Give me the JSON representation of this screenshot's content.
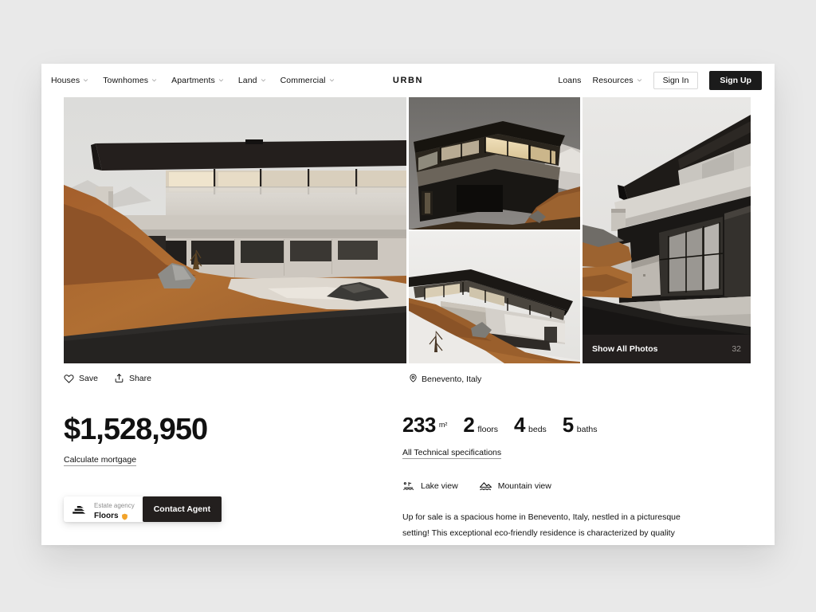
{
  "nav": {
    "left_items": [
      {
        "label": "Houses",
        "has_chevron": true,
        "icon": "chevron-down-icon"
      },
      {
        "label": "Townhomes",
        "has_chevron": true,
        "icon": "chevron-down-icon"
      },
      {
        "label": "Apartments",
        "has_chevron": true,
        "icon": "chevron-down-icon"
      },
      {
        "label": "Land",
        "has_chevron": true,
        "icon": "chevron-down-icon"
      },
      {
        "label": "Commercial",
        "has_chevron": true,
        "icon": "chevron-down-icon"
      }
    ],
    "brand": "URBN",
    "right_items": [
      {
        "label": "Loans",
        "has_chevron": false
      },
      {
        "label": "Resources",
        "has_chevron": true,
        "icon": "chevron-down-icon"
      }
    ],
    "sign_in": "Sign In",
    "sign_up": "Sign Up"
  },
  "gallery": {
    "show_all_label": "Show All Photos",
    "photo_count": "32",
    "images": [
      {
        "name": "hero-exterior-terrace",
        "alt": "Modern hillside house with cantilevered dark roof and glass terrace"
      },
      {
        "name": "thumb-dusk-corner",
        "alt": "Dusk view of house corner with warm interior lighting"
      },
      {
        "name": "thumb-snow-slope",
        "alt": "House on snowy slope with dry orange grass"
      },
      {
        "name": "thumb-entrance",
        "alt": "Entrance driveway view with concrete walls and glazing"
      }
    ]
  },
  "meta": {
    "save_label": "Save",
    "share_label": "Share",
    "location": "Benevento, Italy"
  },
  "listing": {
    "price": "$1,528,950",
    "mortgage_link": "Calculate mortgage",
    "specs_link": "All Technical specifications",
    "specs": [
      {
        "value": "233",
        "unit": "m²",
        "superscript": true
      },
      {
        "value": "2",
        "unit": "floors",
        "superscript": false
      },
      {
        "value": "4",
        "unit": "beds",
        "superscript": false
      },
      {
        "value": "5",
        "unit": "baths",
        "superscript": false
      }
    ],
    "features": [
      {
        "label": "Lake view",
        "icon": "lake-view-icon"
      },
      {
        "label": "Mountain view",
        "icon": "mountain-view-icon"
      }
    ],
    "description": "Up for sale is a spacious home in Benevento, Italy, nestled in a picturesque setting! This exceptional eco-friendly residence is characterized by quality"
  },
  "agency": {
    "role": "Estate agency",
    "name": "Floors",
    "verified_badge_color": "#f2a32a",
    "contact_label": "Contact Agent"
  },
  "colors": {
    "page_background": "#e9e9e9",
    "card_background": "#ffffff",
    "ink": "#111111",
    "dark_button": "#231f1e",
    "muted_text": "#8d8d8d",
    "counter_text": "#9a9693"
  }
}
